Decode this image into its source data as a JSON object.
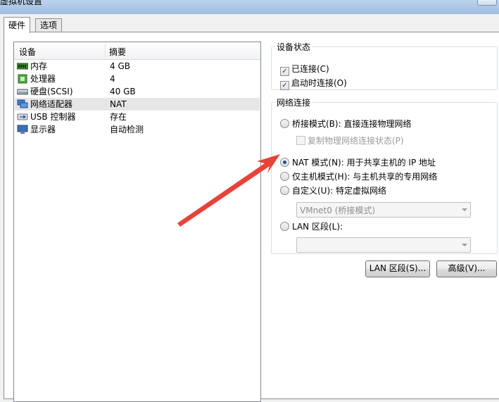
{
  "window": {
    "title": "虚拟机设置"
  },
  "tabs": [
    {
      "label": "硬件",
      "active": true
    },
    {
      "label": "选项",
      "active": false
    }
  ],
  "device_list": {
    "headers": {
      "device": "设备",
      "summary": "摘要"
    },
    "rows": [
      {
        "icon": "memory-icon",
        "name": "内存",
        "summary": "4 GB",
        "selected": false
      },
      {
        "icon": "processor-icon",
        "name": "处理器",
        "summary": "4",
        "selected": false
      },
      {
        "icon": "hard-disk-icon",
        "name": "硬盘(SCSI)",
        "summary": "40 GB",
        "selected": false
      },
      {
        "icon": "network-adapter-icon",
        "name": "网络适配器",
        "summary": "NAT",
        "selected": true
      },
      {
        "icon": "usb-icon",
        "name": "USB 控制器",
        "summary": "存在",
        "selected": false
      },
      {
        "icon": "display-icon",
        "name": "显示器",
        "summary": "自动检测",
        "selected": false
      }
    ]
  },
  "device_status": {
    "legend": "设备状态",
    "connected": {
      "label": "已连接(C)",
      "checked": true
    },
    "connect_at_power_on": {
      "label": "启动时连接(O)",
      "checked": true
    }
  },
  "network": {
    "legend": "网络连接",
    "bridged": {
      "label": "桥接模式(B): 直接连接物理网络",
      "checked": false
    },
    "replicate": {
      "label": "复制物理网络连接状态(P)",
      "checked": false
    },
    "nat": {
      "label": "NAT 模式(N): 用于共享主机的 IP 地址",
      "checked": true
    },
    "host_only": {
      "label": "仅主机模式(H): 与主机共享的专用网络",
      "checked": false
    },
    "custom": {
      "label": "自定义(U): 特定虚拟网络",
      "checked": false
    },
    "custom_select": "VMnet0 (桥接模式)",
    "lan_segment": {
      "label": "LAN 区段(L):",
      "checked": false
    },
    "lan_select": ""
  },
  "buttons": {
    "lan_segments": "LAN 区段(S)...",
    "advanced": "高级(V)..."
  },
  "colors": {
    "arrow": "#e8433a",
    "selection": "#e6e6e6",
    "accent": "#1f4ea3"
  }
}
